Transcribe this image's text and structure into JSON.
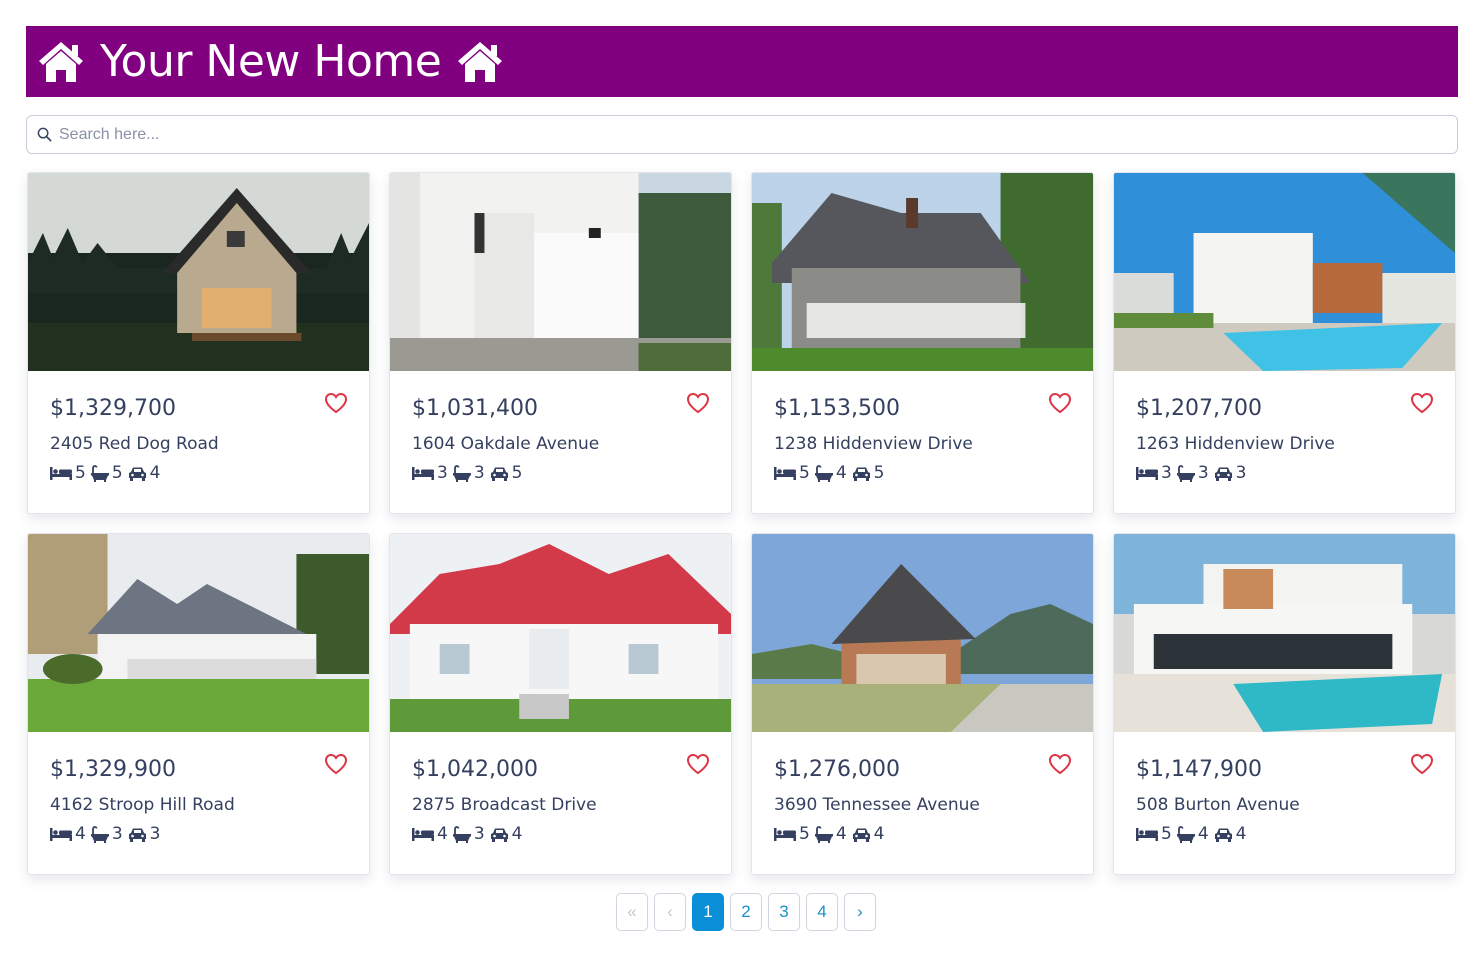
{
  "header": {
    "title": "Your New Home",
    "left_icon": "house-icon",
    "right_icon": "house-icon",
    "background": "#800080"
  },
  "search": {
    "placeholder": "Search here..."
  },
  "listings": [
    {
      "price": "$1,329,700",
      "address": "2405 Red Dog Road",
      "beds": "5",
      "baths": "5",
      "garage": "4"
    },
    {
      "price": "$1,031,400",
      "address": "1604 Oakdale Avenue",
      "beds": "3",
      "baths": "3",
      "garage": "5"
    },
    {
      "price": "$1,153,500",
      "address": "1238 Hiddenview Drive",
      "beds": "5",
      "baths": "4",
      "garage": "5"
    },
    {
      "price": "$1,207,700",
      "address": "1263 Hiddenview Drive",
      "beds": "3",
      "baths": "3",
      "garage": "3"
    },
    {
      "price": "$1,329,900",
      "address": "4162 Stroop Hill Road",
      "beds": "4",
      "baths": "3",
      "garage": "3"
    },
    {
      "price": "$1,042,000",
      "address": "2875 Broadcast Drive",
      "beds": "4",
      "baths": "3",
      "garage": "4"
    },
    {
      "price": "$1,276,000",
      "address": "3690 Tennessee Avenue",
      "beds": "5",
      "baths": "4",
      "garage": "4"
    },
    {
      "price": "$1,147,900",
      "address": "508 Burton Avenue",
      "beds": "5",
      "baths": "4",
      "garage": "4"
    }
  ],
  "pagination": {
    "first": "«",
    "prev": "‹",
    "pages": [
      "1",
      "2",
      "3",
      "4"
    ],
    "next": "›",
    "active_page": "1"
  },
  "colors": {
    "accent": "#0a8fd6",
    "heart": "#dc3545",
    "text": "#354060"
  }
}
